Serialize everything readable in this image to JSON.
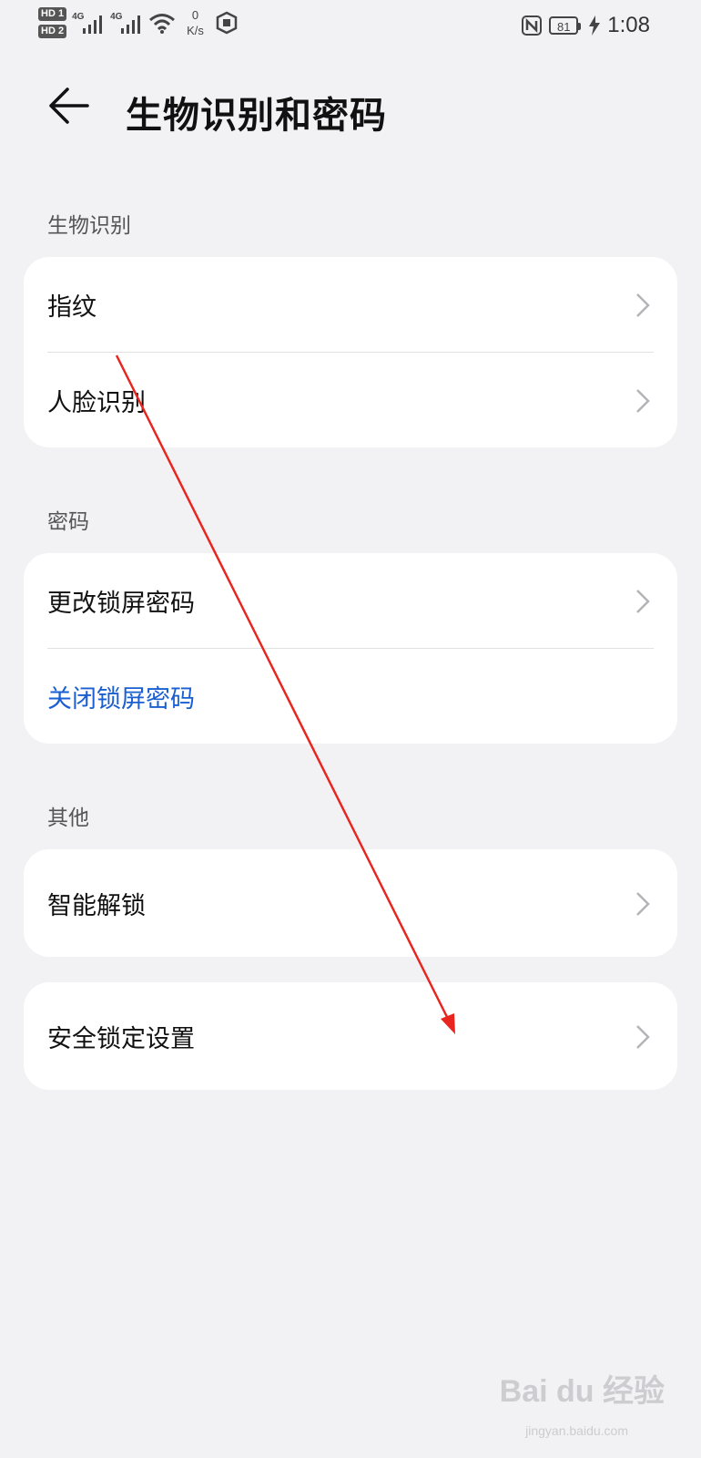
{
  "status_bar": {
    "sim1": "HD 1",
    "sim2": "HD 2",
    "net1": "4G",
    "net2": "4G",
    "speed_value": "0",
    "speed_unit": "K/s",
    "battery": "81",
    "time": "1:08"
  },
  "header": {
    "title": "生物识别和密码",
    "back_icon": "arrow-left-icon"
  },
  "sections": {
    "biometrics": {
      "label": "生物识别",
      "items": [
        {
          "label": "指纹"
        },
        {
          "label": "人脸识别"
        }
      ]
    },
    "password": {
      "label": "密码",
      "items": [
        {
          "label": "更改锁屏密码"
        },
        {
          "label": "关闭锁屏密码"
        }
      ]
    },
    "other": {
      "label": "其他",
      "items": [
        {
          "label": "智能解锁"
        }
      ]
    },
    "security_lock": {
      "items": [
        {
          "label": "安全锁定设置"
        }
      ]
    }
  },
  "watermark": {
    "brand": "Bai du 经验",
    "site": "jingyan.baidu.com"
  },
  "colors": {
    "background": "#f2f2f4",
    "card": "#ffffff",
    "accent_blue": "#1a5fd1",
    "annotation_red": "#e8261f"
  }
}
